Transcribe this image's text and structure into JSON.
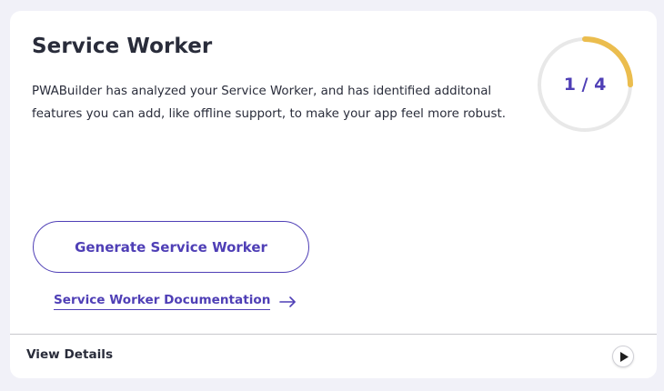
{
  "card": {
    "title": "Service Worker",
    "description": "PWABuilder has analyzed your Service Worker, and has identified additonal features you can add, like offline support, to make your app feel more robust."
  },
  "score": {
    "text": "1 / 4",
    "value": 1,
    "max": 4,
    "ring_color": "#ebbd4e",
    "track_color": "#e8e8e8"
  },
  "actions": {
    "generate_label": "Generate Service Worker",
    "docs_link_label": "Service Worker Documentation",
    "docs_arrow_icon": "arrow-right-icon"
  },
  "footer": {
    "details_label": "View Details",
    "toggle_icon": "play-icon"
  },
  "colors": {
    "accent": "#4f3fb6",
    "text": "#292c3a",
    "page_background": "#f1f1f8"
  }
}
